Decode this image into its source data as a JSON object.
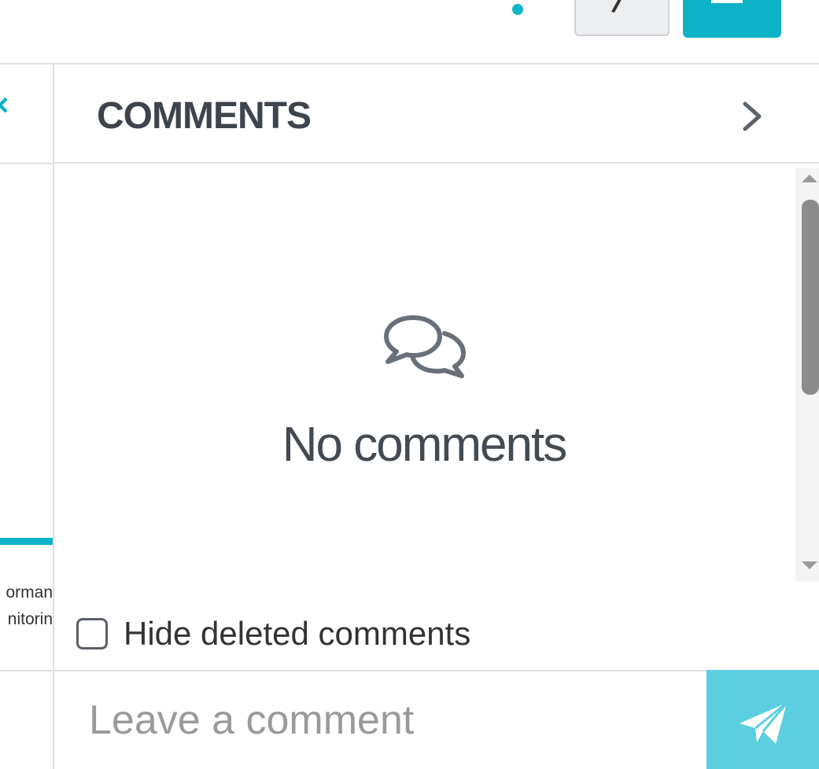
{
  "top_bar": {
    "accent": "#0cb3c8",
    "secondary_button_icon": "pencil-icon",
    "primary_button_icon": "edit-icon"
  },
  "left_panel": {
    "close_icon": "close-icon",
    "text_line_1": "orman",
    "text_line_2": "nitorin"
  },
  "comments_panel": {
    "title": "COMMENTS",
    "collapse_icon": "chevron-right-icon",
    "empty_icon": "comments-icon",
    "empty_text": "No comments",
    "hide_deleted_label": "Hide deleted comments",
    "hide_deleted_checked": false,
    "input_placeholder": "Leave a comment",
    "input_value": "",
    "send_icon": "send-icon",
    "send_color": "#5bcfdf"
  }
}
